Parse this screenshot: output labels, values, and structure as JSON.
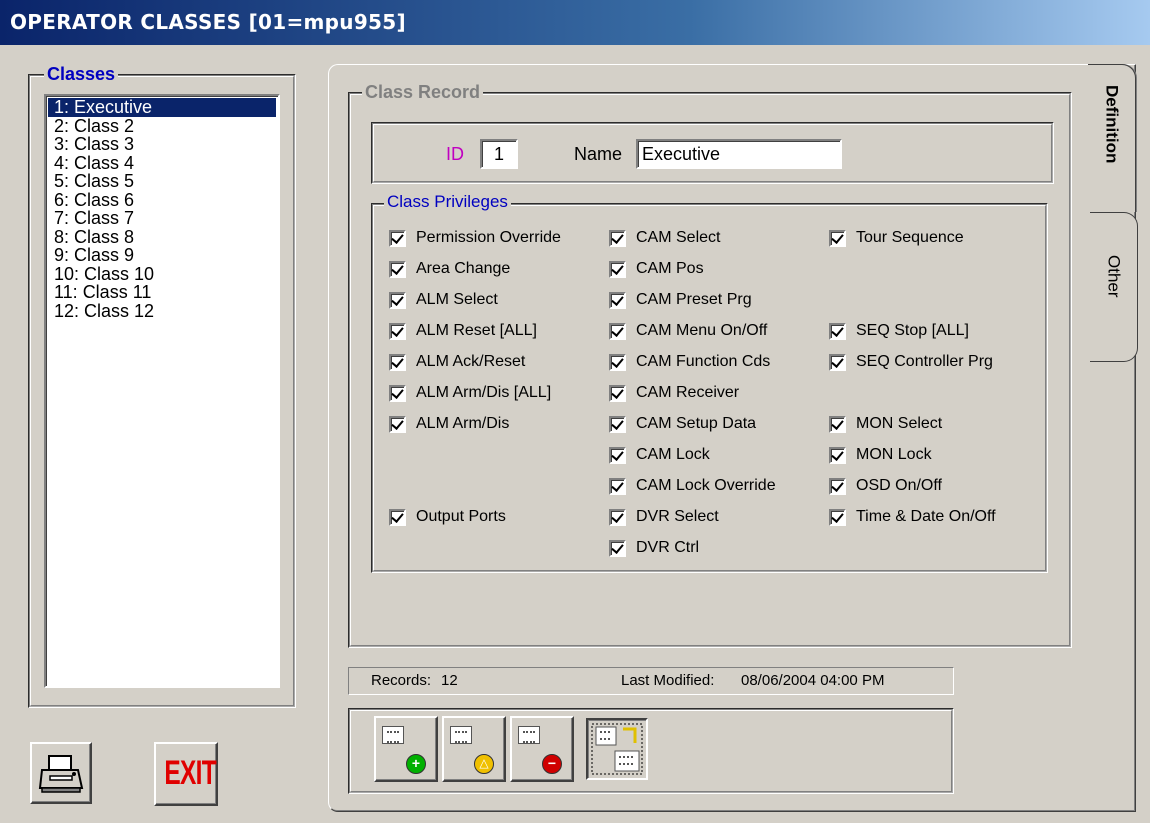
{
  "window": {
    "title": "OPERATOR CLASSES  [01=mpu955]"
  },
  "classes": {
    "legend": "Classes",
    "items": [
      "1: Executive",
      "2: Class 2",
      "3: Class 3",
      "4: Class 4",
      "5: Class 5",
      "6: Class 6",
      "7: Class 7",
      "8: Class 8",
      "9: Class 9",
      "10: Class 10",
      "11: Class 11",
      "12: Class 12"
    ],
    "selected_index": 0
  },
  "tabs": {
    "definition": "Definition",
    "other": "Other",
    "active": "Definition"
  },
  "record": {
    "legend": "Class Record",
    "id_label": "ID",
    "id_value": "1",
    "name_label": "Name",
    "name_value": "Executive"
  },
  "privileges": {
    "legend": "Class Privileges",
    "col1": [
      {
        "label": "Permission Override",
        "checked": true
      },
      {
        "label": "Area Change",
        "checked": true
      },
      {
        "label": "ALM Select",
        "checked": true
      },
      {
        "label": "ALM Reset [ALL]",
        "checked": true
      },
      {
        "label": "ALM Ack/Reset",
        "checked": true
      },
      {
        "label": "ALM Arm/Dis [ALL]",
        "checked": true
      },
      {
        "label": "ALM Arm/Dis",
        "checked": true
      },
      {
        "label": "Output Ports",
        "checked": true
      }
    ],
    "col2": [
      {
        "label": "CAM Select",
        "checked": true
      },
      {
        "label": "CAM Pos",
        "checked": true
      },
      {
        "label": "CAM Preset Prg",
        "checked": true
      },
      {
        "label": "CAM Menu On/Off",
        "checked": true
      },
      {
        "label": "CAM Function Cds",
        "checked": true
      },
      {
        "label": "CAM Receiver",
        "checked": true
      },
      {
        "label": "CAM Setup Data",
        "checked": true
      },
      {
        "label": "CAM Lock",
        "checked": true
      },
      {
        "label": "CAM Lock Override",
        "checked": true
      },
      {
        "label": "DVR Select",
        "checked": true
      },
      {
        "label": "DVR Ctrl",
        "checked": true
      }
    ],
    "col3": [
      {
        "label": "Tour Sequence",
        "checked": true
      },
      {
        "label": "SEQ Stop [ALL]",
        "checked": true
      },
      {
        "label": "SEQ Controller Prg",
        "checked": true
      },
      {
        "label": "MON Select",
        "checked": true
      },
      {
        "label": "MON Lock",
        "checked": true
      },
      {
        "label": "OSD On/Off",
        "checked": true
      },
      {
        "label": "Time & Date On/Off",
        "checked": true
      }
    ]
  },
  "status": {
    "records_label": "Records:",
    "records_value": "12",
    "modified_label": "Last Modified:",
    "modified_value": "08/06/2004 04:00 PM"
  },
  "toolbar": {
    "add_icon": "add-record-icon",
    "edit_icon": "edit-record-icon",
    "delete_icon": "delete-record-icon",
    "copy_icon": "copy-record-icon",
    "add_glyph": "+",
    "edit_glyph": "△",
    "delete_glyph": "−"
  },
  "footer": {
    "exit_label": "EXIT",
    "print_icon": "printer-icon"
  },
  "colors": {
    "title_start": "#0a246a",
    "selection": "#0a246a",
    "legend_blue": "#0000c0",
    "id_magenta": "#c000c0",
    "add_green": "#00b000",
    "edit_yellow": "#f0c000",
    "delete_red": "#d00000",
    "exit_red": "#e00000"
  }
}
